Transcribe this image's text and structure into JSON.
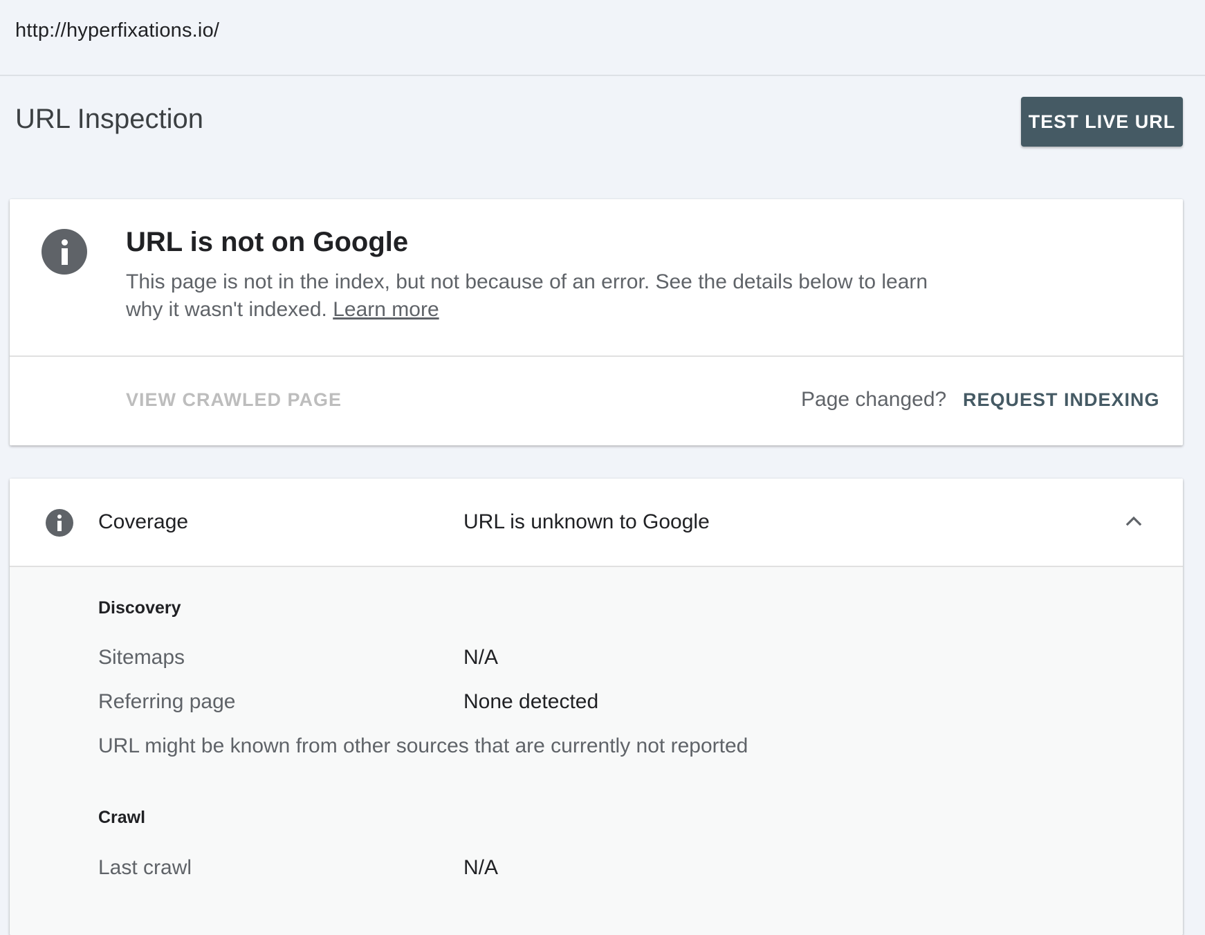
{
  "url_bar": {
    "url": "http://hyperfixations.io/"
  },
  "header": {
    "title": "URL Inspection",
    "test_live_url_label": "TEST LIVE URL"
  },
  "status": {
    "icon": "info-icon",
    "heading": "URL is not on Google",
    "description": "This page is not in the index, but not because of an error. See the details below to learn why it wasn't indexed.",
    "learn_more_label": "Learn more",
    "view_crawled_label": "VIEW CRAWLED PAGE",
    "page_changed_text": "Page changed?",
    "request_indexing_label": "REQUEST INDEXING"
  },
  "coverage": {
    "icon": "info-icon",
    "label": "Coverage",
    "value": "URL is unknown to Google",
    "expanded": true,
    "discovery": {
      "title": "Discovery",
      "sitemaps_label": "Sitemaps",
      "sitemaps_value": "N/A",
      "referring_label": "Referring page",
      "referring_value": "None detected",
      "note": "URL might be known from other sources that are currently not reported"
    },
    "crawl": {
      "title": "Crawl",
      "last_crawl_label": "Last crawl",
      "last_crawl_value": "N/A"
    }
  },
  "colors": {
    "page_background": "#f1f4f9",
    "primary_button": "#455a64",
    "icon_gray": "#5f6368",
    "disabled_text": "#bdbdbd"
  }
}
